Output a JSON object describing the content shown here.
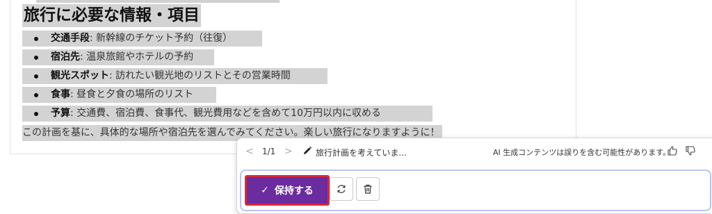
{
  "document": {
    "heading": "旅行に必要な情報・項目",
    "bullets": [
      {
        "label": "交通手段",
        "text": ": 新幹線のチケット予約（往復）"
      },
      {
        "label": "宿泊先",
        "text": ": 温泉旅館やホテルの予約"
      },
      {
        "label": "観光スポット",
        "text": ": 訪れたい観光地のリストとその営業時間"
      },
      {
        "label": "食事",
        "text": ": 昼食と夕食の場所のリスト"
      },
      {
        "label": "予算",
        "text": ": 交通費、宿泊費、食事代、観光費用などを含めて10万円以内に収める"
      }
    ],
    "closing": "この計画を基に、具体的な場所や宿泊先を選んでみてください。楽しい旅行になりますように！"
  },
  "copilot_popup": {
    "prev_symbol": "<",
    "page_counter": "1/1",
    "next_symbol": ">",
    "prompt_text": "旅行計画を考えていま...",
    "ai_notice": "AI 生成コンテンツは誤りを含む可能性があります。",
    "keep_check": "✓",
    "keep_label": "保持する",
    "icons": [
      "pencil-icon",
      "thumbs-up-icon",
      "thumbs-down-icon",
      "regenerate-icon",
      "trash-icon"
    ],
    "colors": {
      "keep_button_bg": "#6a2c9e",
      "highlight_border": "#d8283c",
      "selection": "#d3d3d3"
    }
  }
}
